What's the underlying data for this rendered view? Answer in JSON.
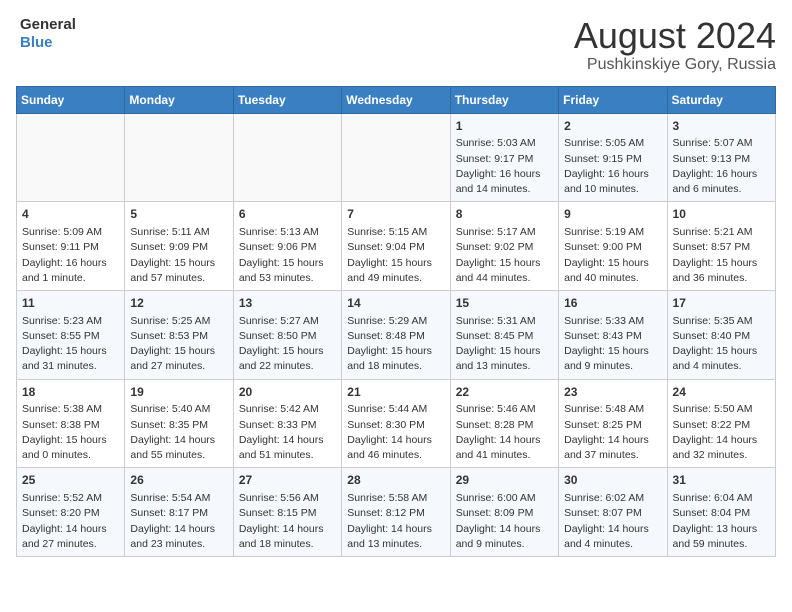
{
  "header": {
    "logo_line1": "General",
    "logo_line2": "Blue",
    "month_year": "August 2024",
    "location": "Pushkinskiye Gory, Russia"
  },
  "weekdays": [
    "Sunday",
    "Monday",
    "Tuesday",
    "Wednesday",
    "Thursday",
    "Friday",
    "Saturday"
  ],
  "weeks": [
    [
      {
        "day": "",
        "info": ""
      },
      {
        "day": "",
        "info": ""
      },
      {
        "day": "",
        "info": ""
      },
      {
        "day": "",
        "info": ""
      },
      {
        "day": "1",
        "info": "Sunrise: 5:03 AM\nSunset: 9:17 PM\nDaylight: 16 hours\nand 14 minutes."
      },
      {
        "day": "2",
        "info": "Sunrise: 5:05 AM\nSunset: 9:15 PM\nDaylight: 16 hours\nand 10 minutes."
      },
      {
        "day": "3",
        "info": "Sunrise: 5:07 AM\nSunset: 9:13 PM\nDaylight: 16 hours\nand 6 minutes."
      }
    ],
    [
      {
        "day": "4",
        "info": "Sunrise: 5:09 AM\nSunset: 9:11 PM\nDaylight: 16 hours\nand 1 minute."
      },
      {
        "day": "5",
        "info": "Sunrise: 5:11 AM\nSunset: 9:09 PM\nDaylight: 15 hours\nand 57 minutes."
      },
      {
        "day": "6",
        "info": "Sunrise: 5:13 AM\nSunset: 9:06 PM\nDaylight: 15 hours\nand 53 minutes."
      },
      {
        "day": "7",
        "info": "Sunrise: 5:15 AM\nSunset: 9:04 PM\nDaylight: 15 hours\nand 49 minutes."
      },
      {
        "day": "8",
        "info": "Sunrise: 5:17 AM\nSunset: 9:02 PM\nDaylight: 15 hours\nand 44 minutes."
      },
      {
        "day": "9",
        "info": "Sunrise: 5:19 AM\nSunset: 9:00 PM\nDaylight: 15 hours\nand 40 minutes."
      },
      {
        "day": "10",
        "info": "Sunrise: 5:21 AM\nSunset: 8:57 PM\nDaylight: 15 hours\nand 36 minutes."
      }
    ],
    [
      {
        "day": "11",
        "info": "Sunrise: 5:23 AM\nSunset: 8:55 PM\nDaylight: 15 hours\nand 31 minutes."
      },
      {
        "day": "12",
        "info": "Sunrise: 5:25 AM\nSunset: 8:53 PM\nDaylight: 15 hours\nand 27 minutes."
      },
      {
        "day": "13",
        "info": "Sunrise: 5:27 AM\nSunset: 8:50 PM\nDaylight: 15 hours\nand 22 minutes."
      },
      {
        "day": "14",
        "info": "Sunrise: 5:29 AM\nSunset: 8:48 PM\nDaylight: 15 hours\nand 18 minutes."
      },
      {
        "day": "15",
        "info": "Sunrise: 5:31 AM\nSunset: 8:45 PM\nDaylight: 15 hours\nand 13 minutes."
      },
      {
        "day": "16",
        "info": "Sunrise: 5:33 AM\nSunset: 8:43 PM\nDaylight: 15 hours\nand 9 minutes."
      },
      {
        "day": "17",
        "info": "Sunrise: 5:35 AM\nSunset: 8:40 PM\nDaylight: 15 hours\nand 4 minutes."
      }
    ],
    [
      {
        "day": "18",
        "info": "Sunrise: 5:38 AM\nSunset: 8:38 PM\nDaylight: 15 hours\nand 0 minutes."
      },
      {
        "day": "19",
        "info": "Sunrise: 5:40 AM\nSunset: 8:35 PM\nDaylight: 14 hours\nand 55 minutes."
      },
      {
        "day": "20",
        "info": "Sunrise: 5:42 AM\nSunset: 8:33 PM\nDaylight: 14 hours\nand 51 minutes."
      },
      {
        "day": "21",
        "info": "Sunrise: 5:44 AM\nSunset: 8:30 PM\nDaylight: 14 hours\nand 46 minutes."
      },
      {
        "day": "22",
        "info": "Sunrise: 5:46 AM\nSunset: 8:28 PM\nDaylight: 14 hours\nand 41 minutes."
      },
      {
        "day": "23",
        "info": "Sunrise: 5:48 AM\nSunset: 8:25 PM\nDaylight: 14 hours\nand 37 minutes."
      },
      {
        "day": "24",
        "info": "Sunrise: 5:50 AM\nSunset: 8:22 PM\nDaylight: 14 hours\nand 32 minutes."
      }
    ],
    [
      {
        "day": "25",
        "info": "Sunrise: 5:52 AM\nSunset: 8:20 PM\nDaylight: 14 hours\nand 27 minutes."
      },
      {
        "day": "26",
        "info": "Sunrise: 5:54 AM\nSunset: 8:17 PM\nDaylight: 14 hours\nand 23 minutes."
      },
      {
        "day": "27",
        "info": "Sunrise: 5:56 AM\nSunset: 8:15 PM\nDaylight: 14 hours\nand 18 minutes."
      },
      {
        "day": "28",
        "info": "Sunrise: 5:58 AM\nSunset: 8:12 PM\nDaylight: 14 hours\nand 13 minutes."
      },
      {
        "day": "29",
        "info": "Sunrise: 6:00 AM\nSunset: 8:09 PM\nDaylight: 14 hours\nand 9 minutes."
      },
      {
        "day": "30",
        "info": "Sunrise: 6:02 AM\nSunset: 8:07 PM\nDaylight: 14 hours\nand 4 minutes."
      },
      {
        "day": "31",
        "info": "Sunrise: 6:04 AM\nSunset: 8:04 PM\nDaylight: 13 hours\nand 59 minutes."
      }
    ]
  ]
}
